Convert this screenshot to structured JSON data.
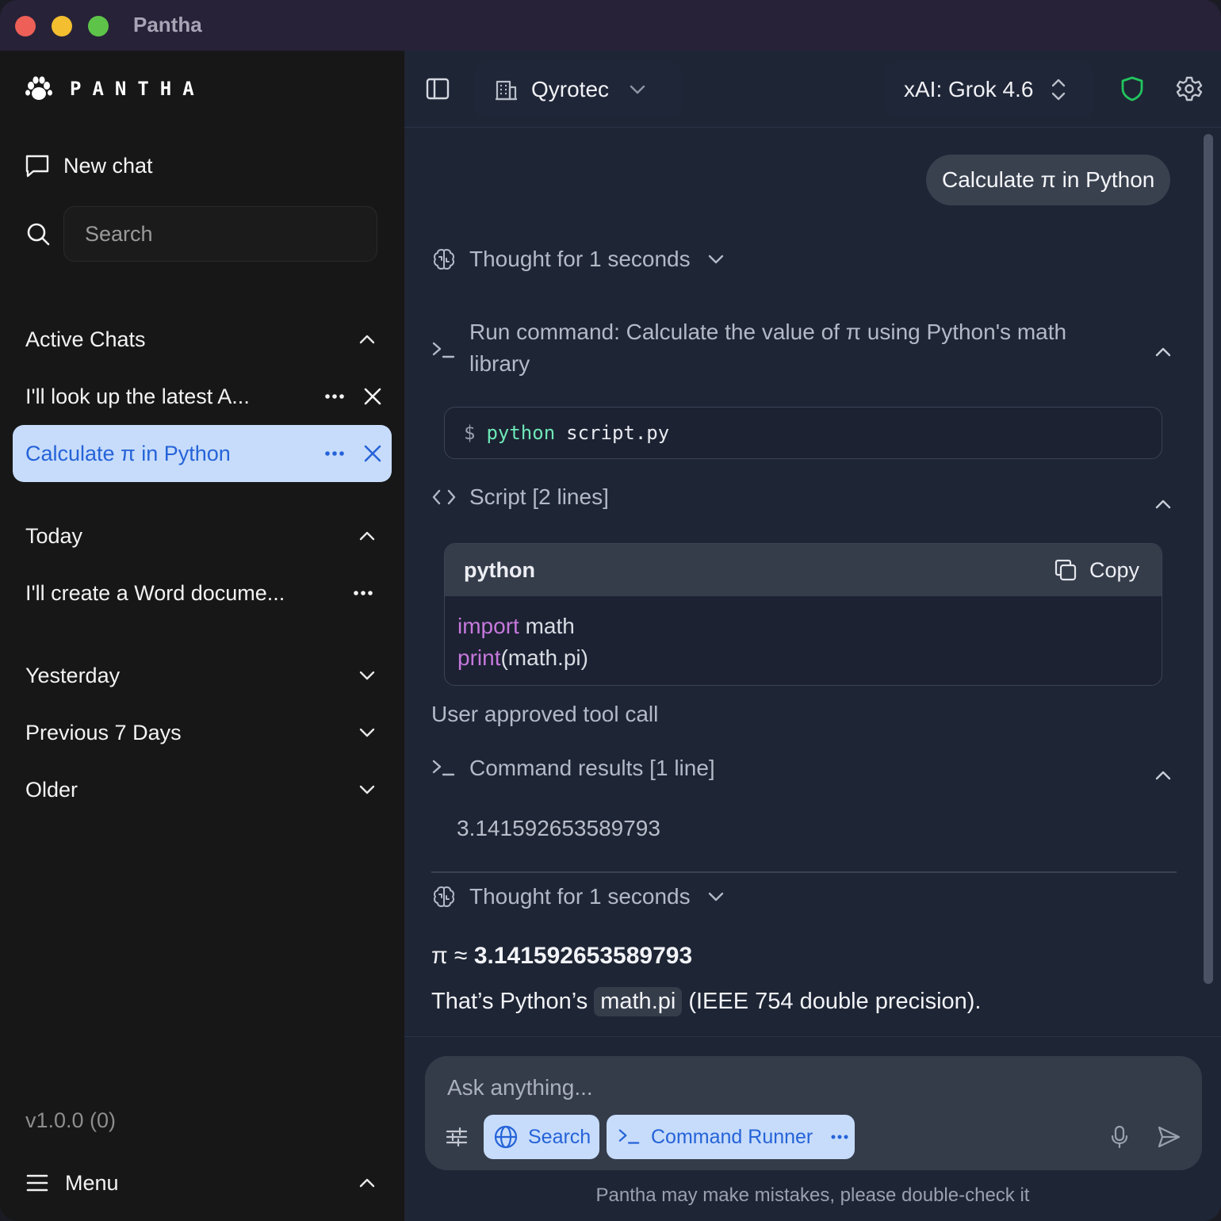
{
  "window": {
    "title": "Pantha"
  },
  "sidebar": {
    "logo_text": "PANTHA",
    "new_chat_label": "New chat",
    "search_placeholder": "Search",
    "sections": {
      "active": "Active Chats",
      "today": "Today",
      "yesterday": "Yesterday",
      "previous7": "Previous 7 Days",
      "older": "Older"
    },
    "active_chats": [
      {
        "title": "I'll look up the latest A..."
      },
      {
        "title": "Calculate π in Python"
      }
    ],
    "today_chats": [
      {
        "title": "I'll create a Word docume..."
      }
    ],
    "version": "v1.0.0 (0)",
    "menu_label": "Menu"
  },
  "topbar": {
    "workspace": "Qyrotec",
    "model": "xAI: Grok 4.6"
  },
  "conversation": {
    "user_message": "Calculate π in Python",
    "thought_1": "Thought for 1 seconds",
    "run_command_line1": "Run command: Calculate the value of π using Python's math",
    "run_command_line2": "library",
    "command": {
      "prompt": "$",
      "program": "python",
      "args": "script.py"
    },
    "script_header": "Script [2 lines]",
    "code": {
      "language": "python",
      "copy_label": "Copy",
      "line1_kw": "import",
      "line1_rest": " math",
      "line2_kw": "print",
      "line2_rest": "(math.pi)"
    },
    "approved": "User approved tool call",
    "results_header": "Command results [1 line]",
    "result_value": "3.141592653589793",
    "thought_2": "Thought for 1 seconds",
    "answer_prefix": "π ≈ ",
    "answer_bold": "3.141592653589793",
    "answer2_pre": "That’s Python’s",
    "answer2_code": "math.pi",
    "answer2_post": "(IEEE 754 double precision)."
  },
  "composer": {
    "placeholder": "Ask anything...",
    "search_tool": "Search",
    "command_tool": "Command Runner",
    "disclaimer": "Pantha may make mistakes, please double-check it"
  },
  "colors": {
    "accent": "#2563d8",
    "accent_bg": "#c7dcfb",
    "shield": "#22c55e",
    "keyword": "#c678dd",
    "shell_program": "#6ee7b7"
  }
}
